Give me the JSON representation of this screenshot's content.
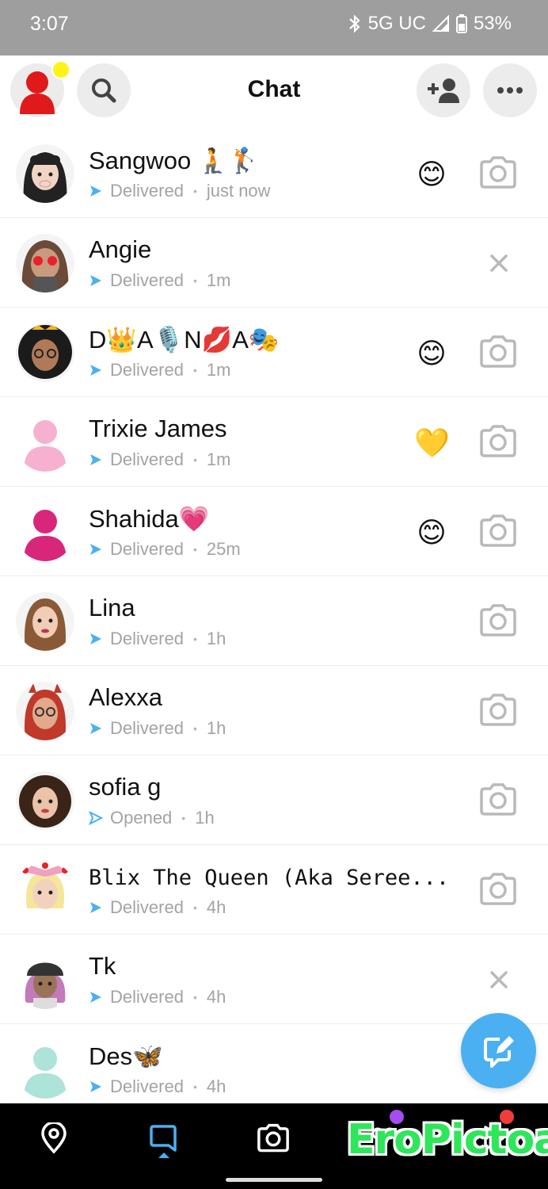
{
  "status_bar": {
    "time": "3:07",
    "network": "5G UC",
    "battery": "53%",
    "icons": [
      "bluetooth-icon",
      "signal-icon",
      "battery-icon"
    ]
  },
  "header": {
    "title": "Chat",
    "buttons": [
      "profile-avatar",
      "search-icon",
      "add-friend-icon",
      "more-icon"
    ]
  },
  "colors": {
    "delivered_arrow": "#4ab0f2",
    "fab": "#4ab0f2",
    "notification_dot": "#fff21a",
    "status_bar": "#9e9e9e",
    "nav_bg": "#000000",
    "stories_badge": "#a64cf0",
    "spotlight_badge": "#f23c3c"
  },
  "chats": [
    {
      "name": "Sangwoo 🧎🏌",
      "status": "Delivered",
      "time": "just now",
      "emoji": "😊",
      "action": "camera"
    },
    {
      "name": "Angie",
      "status": "Delivered",
      "time": "1m",
      "emoji": "",
      "action": "close"
    },
    {
      "name": "D👑A🎙️N💋A🎭",
      "status": "Delivered",
      "time": "1m",
      "emoji": "😊",
      "action": "camera"
    },
    {
      "name": "Trixie James",
      "status": "Delivered",
      "time": "1m",
      "emoji": "💛",
      "action": "camera"
    },
    {
      "name": "Shahida💗",
      "status": "Delivered",
      "time": "25m",
      "emoji": "😊",
      "action": "camera"
    },
    {
      "name": "Lina",
      "status": "Delivered",
      "time": "1h",
      "emoji": "",
      "action": "camera"
    },
    {
      "name": "Alexxa",
      "status": "Delivered",
      "time": "1h",
      "emoji": "",
      "action": "camera"
    },
    {
      "name": "sofia g",
      "status": "Opened",
      "time": "1h",
      "emoji": "",
      "action": "camera"
    },
    {
      "name": "Blix The Queen (Aka Seree...",
      "status": "Delivered",
      "time": "4h",
      "emoji": "",
      "action": "camera"
    },
    {
      "name": "Tk",
      "status": "Delivered",
      "time": "4h",
      "emoji": "",
      "action": "close"
    },
    {
      "name": "Des🦋",
      "status": "Delivered",
      "time": "4h",
      "emoji": "",
      "action": "none"
    }
  ],
  "fab": {
    "icon": "new-chat-icon"
  },
  "bottom_nav": [
    "map-icon",
    "chat-icon",
    "camera-icon",
    "stories-icon",
    "spotlight-icon"
  ],
  "watermark": "EroPictoa"
}
